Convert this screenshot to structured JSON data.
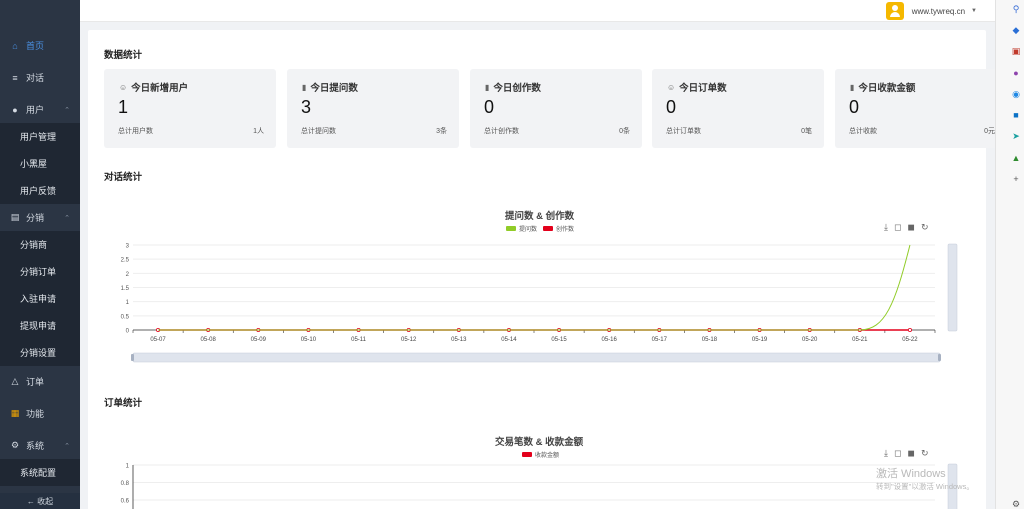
{
  "sidebar": {
    "items": [
      {
        "label": "首页",
        "icon": "home-icon"
      },
      {
        "label": "对话",
        "icon": "list-icon"
      },
      {
        "label": "用户",
        "icon": "user-icon"
      },
      {
        "label": "分销",
        "icon": "share-icon"
      },
      {
        "label": "订单",
        "icon": "money-bag-icon"
      },
      {
        "label": "功能",
        "icon": "grid-icon"
      },
      {
        "label": "系统",
        "icon": "gear-icon"
      }
    ],
    "user_sub": [
      "用户管理",
      "小黑屋",
      "用户反馈"
    ],
    "dist_sub": [
      "分销商",
      "分销订单",
      "入驻申请",
      "提现申请",
      "分销设置"
    ],
    "system_sub": [
      "系统配置"
    ],
    "collapse_label": "← 收起"
  },
  "topbar": {
    "site": "www.tywreq.cn",
    "caret": "▼"
  },
  "stats": {
    "section_title": "数据统计",
    "cards": [
      {
        "title": "今日新增用户",
        "icon": "user-icon",
        "value": "1",
        "foot_label": "总计用户数",
        "foot_value": "1人"
      },
      {
        "title": "今日提问数",
        "icon": "bar-chart-icon",
        "value": "3",
        "foot_label": "总计提问数",
        "foot_value": "3条"
      },
      {
        "title": "今日创作数",
        "icon": "bar-chart-icon",
        "value": "0",
        "foot_label": "总计创作数",
        "foot_value": "0条"
      },
      {
        "title": "今日订单数",
        "icon": "user-icon",
        "value": "0",
        "foot_label": "总计订单数",
        "foot_value": "0笔"
      },
      {
        "title": "今日收款金额",
        "icon": "bar-chart-icon",
        "value": "0",
        "foot_label": "总计收款",
        "foot_value": "0元"
      }
    ]
  },
  "dialog_section": {
    "title": "对话统计"
  },
  "order_section": {
    "title": "订单统计"
  },
  "toolbox": [
    "download-icon",
    "zoom-icon",
    "zoom-reset-icon",
    "restore-icon"
  ],
  "watermark": {
    "line1": "激活 Windows",
    "line2": "转到\"设置\"以激活 Windows。"
  },
  "chart_data": [
    {
      "type": "line",
      "title": "提问数 & 创作数",
      "categories": [
        "05-07",
        "05-08",
        "05-09",
        "05-10",
        "05-11",
        "05-12",
        "05-13",
        "05-14",
        "05-15",
        "05-16",
        "05-17",
        "05-18",
        "05-19",
        "05-20",
        "05-21",
        "05-22"
      ],
      "series": [
        {
          "name": "提问数",
          "color": "#91cc28",
          "values": [
            0,
            0,
            0,
            0,
            0,
            0,
            0,
            0,
            0,
            0,
            0,
            0,
            0,
            0,
            0,
            3
          ]
        },
        {
          "name": "创作数",
          "color": "#e3001b",
          "values": [
            0,
            0,
            0,
            0,
            0,
            0,
            0,
            0,
            0,
            0,
            0,
            0,
            0,
            0,
            0,
            0
          ]
        }
      ],
      "yticks": [
        "0",
        "0.5",
        "1",
        "1.5",
        "2",
        "2.5",
        "3"
      ],
      "ylim": [
        0,
        3
      ],
      "legend": "top-center",
      "grid": true
    },
    {
      "type": "line",
      "title": "交易笔数 & 收款金额",
      "series": [
        {
          "name": "收款金额",
          "color": "#e3001b",
          "values": []
        }
      ],
      "yticks": [
        "0.6",
        "0.8",
        "1"
      ],
      "ylim": [
        0,
        1
      ],
      "legend": "top-center",
      "grid": true
    }
  ]
}
